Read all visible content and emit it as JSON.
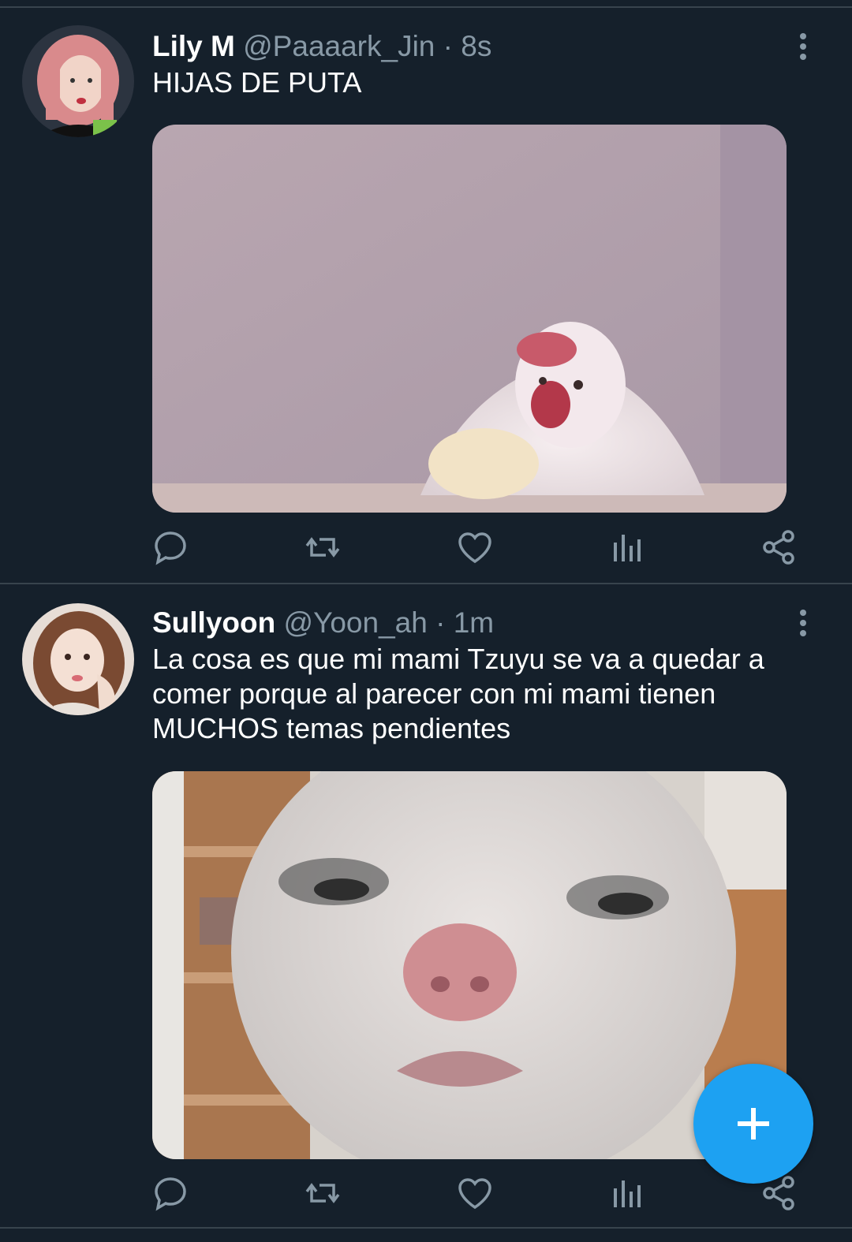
{
  "tweets": [
    {
      "name": "Lily M",
      "handle": "@Paaaark_Jin",
      "time": "· 8s",
      "text": "HIJAS DE PUTA"
    },
    {
      "name": "Sullyoon",
      "handle": "@Yoon_ah",
      "time": "· 1m",
      "text": "La cosa es que mi mami Tzuyu se va a quedar a comer porque al parecer con mi mami tienen MUCHOS temas pendientes"
    }
  ],
  "icons": [
    "reply-icon",
    "retweet-icon",
    "like-icon",
    "analytics-icon",
    "share-icon",
    "more-vertical-icon",
    "plus-icon"
  ],
  "colors": {
    "background": "#15202b",
    "divider": "#38444d",
    "secondary_text": "#8899a6",
    "accent": "#1da1f2"
  }
}
